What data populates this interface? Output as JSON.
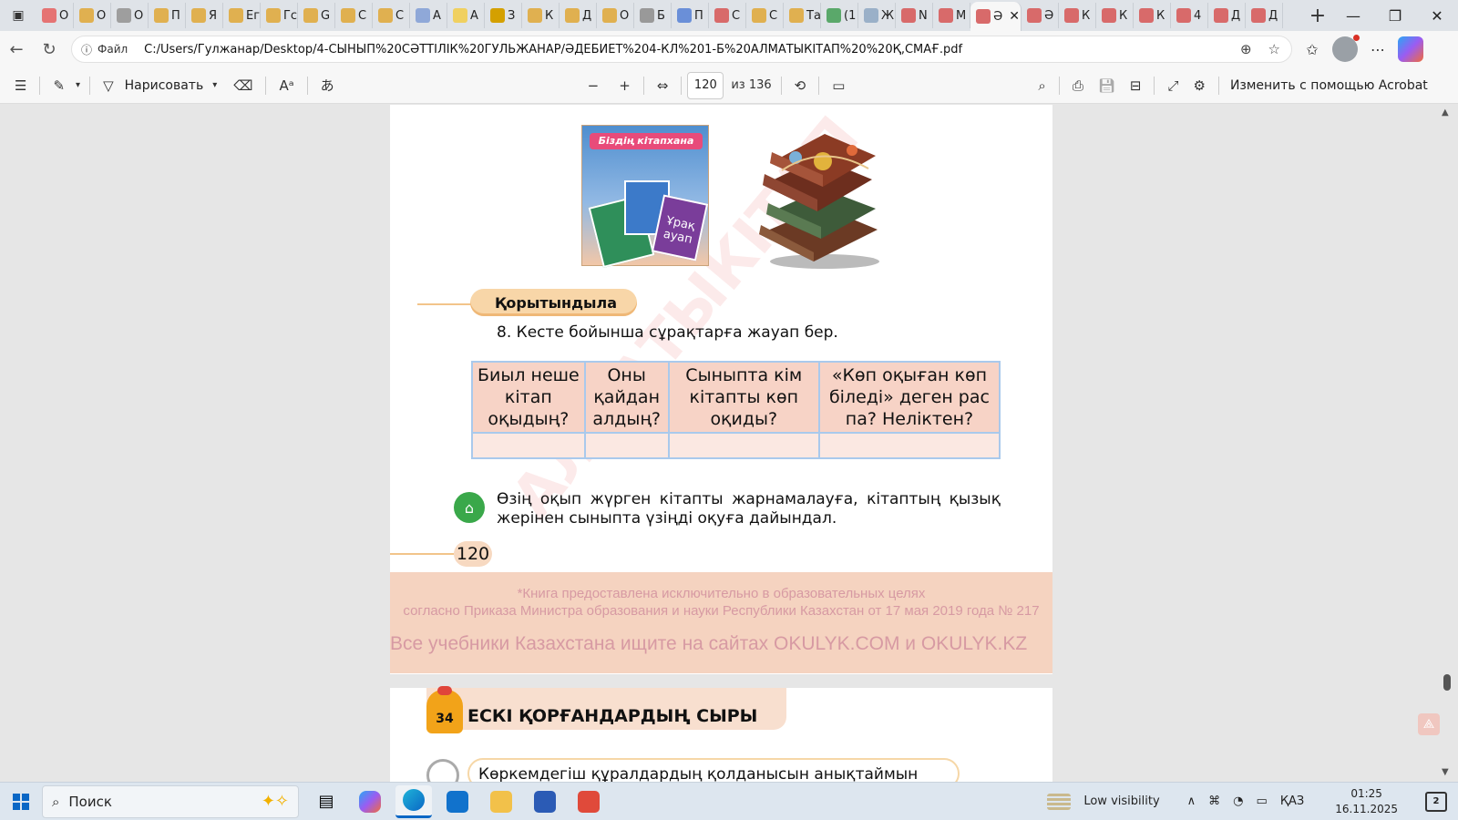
{
  "browser": {
    "tabs": [
      {
        "letter": "О",
        "color": "#e57373"
      },
      {
        "letter": "О",
        "color": "#e0b050"
      },
      {
        "letter": "О",
        "color": "#9e9e9e"
      },
      {
        "letter": "П",
        "color": "#e0b050"
      },
      {
        "letter": "Я",
        "color": "#e0b050"
      },
      {
        "letter": "Ег",
        "color": "#e0b050"
      },
      {
        "letter": "Гс",
        "color": "#e0b050"
      },
      {
        "letter": "G",
        "color": "#e0b050"
      },
      {
        "letter": "С",
        "color": "#e0b050"
      },
      {
        "letter": "С",
        "color": "#e0b050"
      },
      {
        "letter": "А",
        "color": "#8fa8d8"
      },
      {
        "letter": "А",
        "color": "#f0d060"
      },
      {
        "letter": "З",
        "color": "#d4a000"
      },
      {
        "letter": "К",
        "color": "#e0b050"
      },
      {
        "letter": "Д",
        "color": "#e0b050"
      },
      {
        "letter": "О",
        "color": "#e0b050"
      },
      {
        "letter": "Б",
        "color": "#999999"
      },
      {
        "letter": "П",
        "color": "#6a8fd8"
      },
      {
        "letter": "С",
        "color": "#d86a6a"
      },
      {
        "letter": "С",
        "color": "#e0b050"
      },
      {
        "letter": "Та",
        "color": "#e0b050"
      },
      {
        "letter": "(1",
        "color": "#5aa86a"
      },
      {
        "letter": "Ж",
        "color": "#9ab0c8"
      },
      {
        "letter": "N",
        "color": "#d86a6a"
      },
      {
        "letter": "М",
        "color": "#d86a6a"
      }
    ],
    "active_tab": {
      "letter": "Ә",
      "color": "#d86a6a"
    },
    "tabs_after": [
      {
        "letter": "Ә",
        "color": "#d86a6a"
      },
      {
        "letter": "К",
        "color": "#d86a6a"
      },
      {
        "letter": "К",
        "color": "#d86a6a"
      },
      {
        "letter": "К",
        "color": "#d86a6a"
      },
      {
        "letter": "4",
        "color": "#d86a6a"
      },
      {
        "letter": "Д",
        "color": "#d86a6a"
      },
      {
        "letter": "Д",
        "color": "#d86a6a"
      }
    ],
    "file_label": "Файл",
    "url": "C:/Users/Гулжанар/Desktop/4-СЫНЫП%20СӘТТІЛІК%20ГУЛЬЖАНАР/ӘДЕБИЕТ%204-КЛ%201-Б%20АЛМАТЫКІТАП%20%20Қ,СМАҒ.pdf"
  },
  "pdf_toolbar": {
    "draw_label": "Нарисовать",
    "current_page": "120",
    "page_of": "из 136",
    "edit_acrobat": "Изменить с помощью Acrobat"
  },
  "document": {
    "poster_title": "Біздің кітапхана",
    "poster_book_text": "Ұрақ ауап",
    "watermark": "АЛМАТЫКІТАП",
    "section_title": "Қорытындыла",
    "question": "8. Кесте бойынша сұрақтарға жауап бер.",
    "table_headers": [
      "Биыл неше кітап оқыдың?",
      "Оны қайдан алдың?",
      "Сыныпта кім кітапты көп оқиды?",
      "«Көп оқыған көп біледі» деген рас па? Неліктен?"
    ],
    "homework": "Өзің оқып жүрген кітапты жарнамалауға, кітаптың қызық жерінен сыныпта үзіңді оқуға дайындал.",
    "page_number": "120",
    "notice_line1": "*Книга предоставлена исключительно в образовательных целях",
    "notice_line2": "согласно Приказа Министра образования и науки Республики Казахстан от 17 мая 2019 года № 217",
    "notice_line3": "Все учебники Казахстана ищите на сайтах OKULYK.COM и OKULYK.KZ",
    "chapter_number": "34",
    "chapter_title": "ЕСКІ ҚОРҒАНДАРДЫҢ СЫРЫ",
    "chapter_subtitle": "Көркемдегіш құралдардың қолданысын анықтаймын"
  },
  "taskbar": {
    "search": "Поиск",
    "low_visibility": "Low visibility",
    "lang": "ҚАЗ",
    "time": "01:25",
    "date": "16.11.2025",
    "notif_count": "2"
  }
}
